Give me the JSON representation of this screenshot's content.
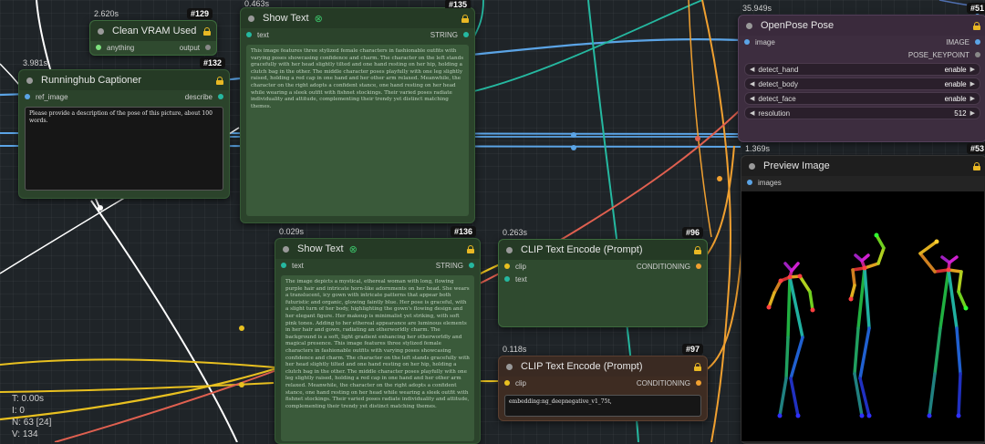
{
  "colors": {
    "wire_blue": "#5ba4e6",
    "wire_orange": "#f0a030",
    "wire_yellow": "#e8c020",
    "wire_red": "#e06050",
    "wire_teal": "#25b8a0",
    "wire_white": "#ffffff"
  },
  "nodes": {
    "clean_vram": {
      "timer": "2.620s",
      "id": "#129",
      "title": "Clean VRAM Used",
      "input_label": "anything",
      "output_label": "output"
    },
    "captioner": {
      "timer": "3.981s",
      "id": "#132",
      "title": "Runninghub Captioner",
      "input_label": "ref_image",
      "output_label": "describe",
      "prompt": "Please provide a description of the pose of this picture, about 100 words."
    },
    "show_text_135": {
      "timer": "0.463s",
      "id": "#135",
      "title": "Show Text",
      "input_label": "text",
      "output_label": "STRING",
      "content": "This image features three stylized female characters in fashionable outfits with varying poses showcasing confidence and charm. The character on the left stands gracefully with her head slightly tilted and one hand resting on her hip, holding a clutch bag in the other. The middle character poses playfully with one leg slightly raised, holding a red cap in one hand and her other arm relaxed. Meanwhile, the character on the right adopts a confident stance, one hand resting on her head while wearing a sleek outfit with fishnet stockings. Their varied poses radiate individuality and attitude, complementing their trendy yet distinct matching themes."
    },
    "show_text_136": {
      "timer": "0.029s",
      "id": "#136",
      "title": "Show Text",
      "input_label": "text",
      "output_label": "STRING",
      "content": "The image depicts a mystical, ethereal woman with long, flowing purple hair and intricate horn-like adornments on her head. She wears a translucent, icy gown with intricate patterns that appear both futuristic and organic, glowing faintly blue. Her pose is graceful, with a slight turn of her body, highlighting the gown's flowing design and her elegant figure. Her makeup is minimalist yet striking, with soft pink tones. Adding to her ethereal appearance are luminous elements in her hair and gown, radiating an otherworldly charm. The background is a soft, light gradient enhancing her otherworldly and magical presence. This image features three stylized female characters in fashionable outfits with varying poses showcasing confidence and charm. The character on the left stands gracefully with her head slightly tilted and one hand resting on her hip, holding a clutch bag in the other. The middle character poses playfully with one leg slightly raised, holding a red cap in one hand and her other arm relaxed. Meanwhile, the character on the right adopts a confident stance, one hand resting on her head while wearing a sleek outfit with fishnet stockings. Their varied poses radiate individuality and attitude, complementing their trendy yet distinct matching themes."
    },
    "clip_96": {
      "timer": "0.263s",
      "id": "#96",
      "title": "CLIP Text Encode (Prompt)",
      "input_clip": "clip",
      "input_text": "text",
      "output_label": "CONDITIONING"
    },
    "clip_97": {
      "timer": "0.118s",
      "id": "#97",
      "title": "CLIP Text Encode (Prompt)",
      "input_clip": "clip",
      "output_label": "CONDITIONING",
      "prompt": "embedding:ng_deepnegative_v1_75t,"
    },
    "openpose": {
      "timer": "35.949s",
      "id": "#51",
      "title": "OpenPose Pose",
      "input_label": "image",
      "output_image": "IMAGE",
      "output_keypoint": "POSE_KEYPOINT",
      "widgets": [
        {
          "label": "detect_hand",
          "value": "enable"
        },
        {
          "label": "detect_body",
          "value": "enable"
        },
        {
          "label": "detect_face",
          "value": "enable"
        },
        {
          "label": "resolution",
          "value": "512"
        }
      ]
    },
    "preview": {
      "timer": "1.369s",
      "id": "#53",
      "title": "Preview Image",
      "input_label": "images"
    }
  },
  "stats": {
    "t": "T: 0.00s",
    "i": "I: 0",
    "n": "N: 63 [24]",
    "v": "V: 134"
  }
}
